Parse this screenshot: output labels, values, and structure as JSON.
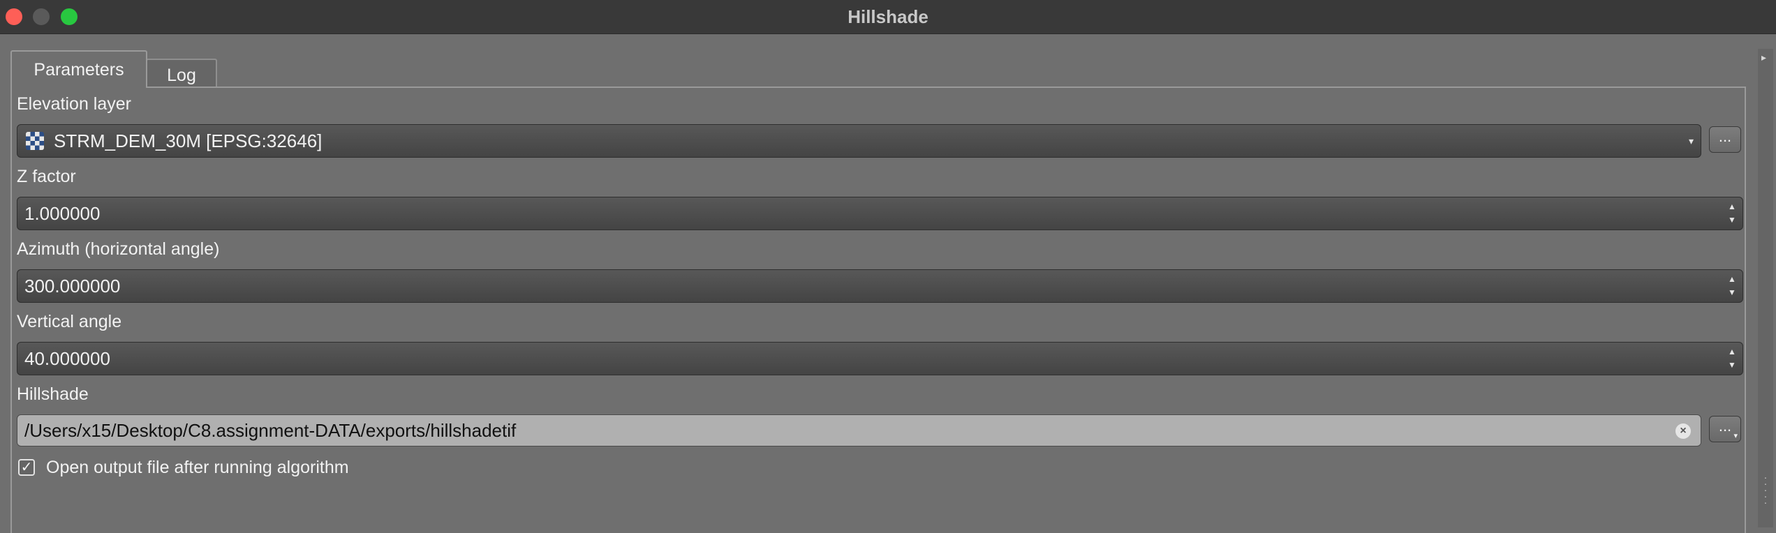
{
  "window": {
    "title": "Hillshade"
  },
  "tabs": [
    {
      "label": "Parameters",
      "active": true
    },
    {
      "label": "Log",
      "active": false
    }
  ],
  "fields": {
    "elevation_layer": {
      "label": "Elevation layer",
      "value": "STRM_DEM_30M [EPSG:32646]",
      "icon": "raster-layer-icon",
      "browse_label": "..."
    },
    "z_factor": {
      "label": "Z factor",
      "value": "1.000000"
    },
    "azimuth": {
      "label": "Azimuth (horizontal angle)",
      "value": "300.000000"
    },
    "vertical_angle": {
      "label": "Vertical angle",
      "value": "40.000000"
    },
    "hillshade": {
      "label": "Hillshade",
      "value": "/Users/x15/Desktop/C8.assignment-DATA/exports/hillshadetif",
      "browse_label": "..."
    }
  },
  "open_output": {
    "label": "Open output file after running algorithm",
    "checked": true
  },
  "colors": {
    "background": "#6f6f6f",
    "titlebar": "#393939",
    "close": "#fe5f57",
    "maximize": "#28c840",
    "path_field": "#b0b0b0"
  }
}
